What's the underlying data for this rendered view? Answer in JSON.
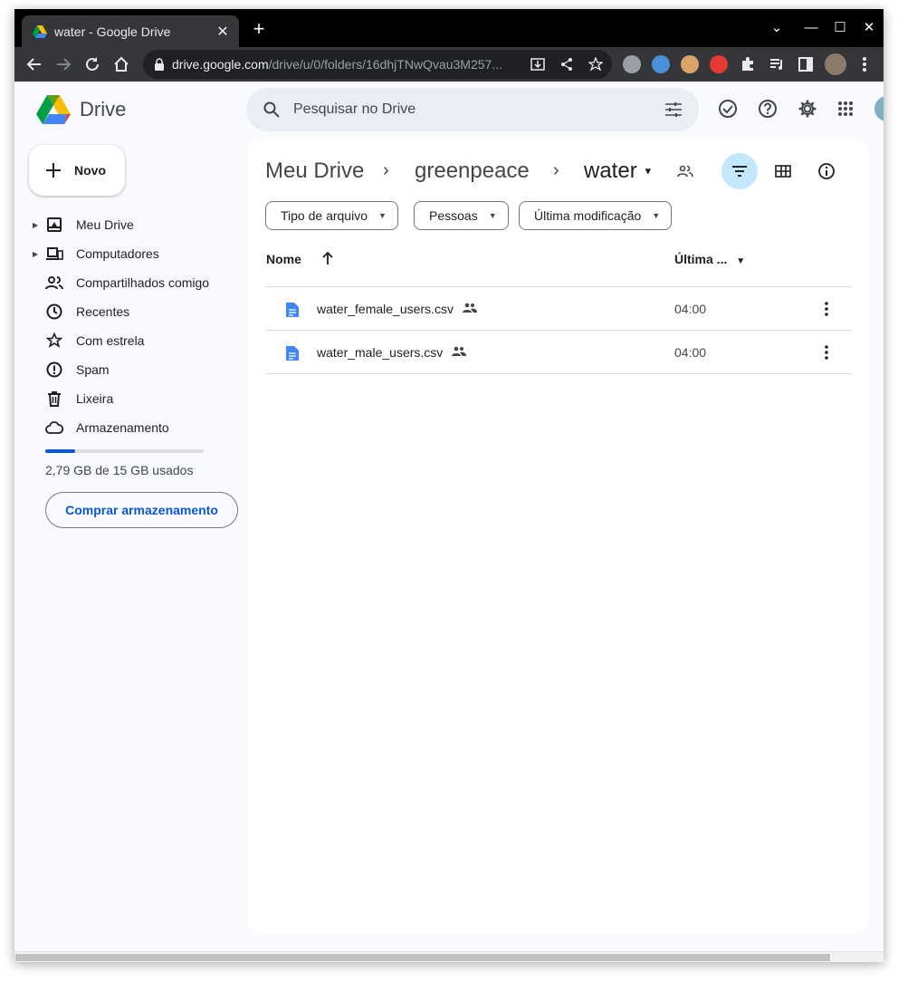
{
  "browser": {
    "tab_title": "water - Google Drive",
    "url_host": "drive.google.com",
    "url_path": "/drive/u/0/folders/16dhjTNwQvau3M257..."
  },
  "drive": {
    "logo_text": "Drive",
    "search_placeholder": "Pesquisar no Drive"
  },
  "sidebar": {
    "new_label": "Novo",
    "items": [
      {
        "label": "Meu Drive",
        "icon": "my-drive-icon"
      },
      {
        "label": "Computadores",
        "icon": "computers-icon"
      },
      {
        "label": "Compartilhados comigo",
        "icon": "shared-icon"
      },
      {
        "label": "Recentes",
        "icon": "clock-icon"
      },
      {
        "label": "Com estrela",
        "icon": "star-icon"
      },
      {
        "label": "Spam",
        "icon": "spam-icon"
      },
      {
        "label": "Lixeira",
        "icon": "trash-icon"
      },
      {
        "label": "Armazenamento",
        "icon": "cloud-icon"
      }
    ],
    "storage_text": "2,79 GB de 15 GB usados",
    "storage_used_fraction": 0.186,
    "buy_storage_label": "Comprar armazenamento"
  },
  "main": {
    "breadcrumb": [
      "Meu Drive",
      "greenpeace",
      "water"
    ],
    "filters": [
      "Tipo de arquivo",
      "Pessoas",
      "Última modificação"
    ],
    "columns": {
      "name": "Nome",
      "modified": "Última ..."
    },
    "files": [
      {
        "name": "water_female_users.csv",
        "modified": "04:00",
        "shared": true
      },
      {
        "name": "water_male_users.csv",
        "modified": "04:00",
        "shared": true
      }
    ]
  },
  "colors": {
    "accent": "#0b57d0",
    "filter_active": "#c2e7ff"
  }
}
